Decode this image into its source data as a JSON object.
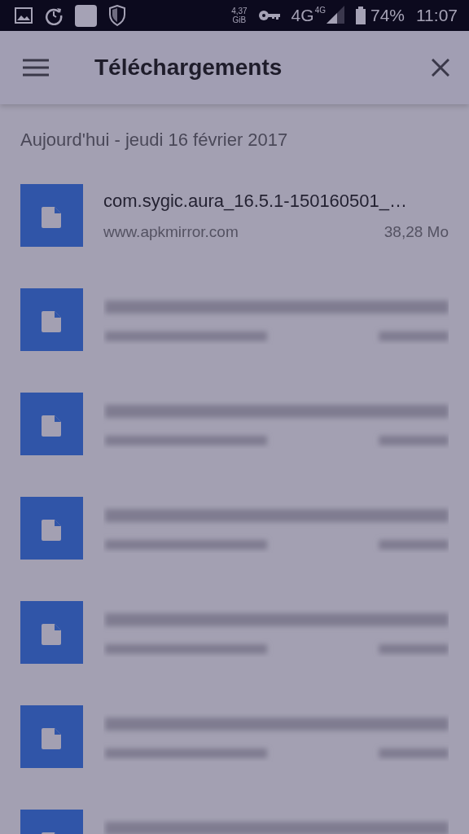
{
  "status_bar": {
    "storage": "4,37",
    "storage_unit": "GiB",
    "network": "4G",
    "network_small": "4G",
    "battery": "74%",
    "time": "11:07"
  },
  "toolbar": {
    "title": "Téléchargements"
  },
  "section": {
    "heading": "Aujourd'hui - jeudi 16 février 2017"
  },
  "downloads": [
    {
      "kind": "file",
      "name": "com.sygic.aura_16.5.1-150160501_…",
      "source": "www.apkmirror.com",
      "size": "38,28 Mo"
    },
    {
      "kind": "blurred"
    },
    {
      "kind": "blurred"
    },
    {
      "kind": "blurred"
    },
    {
      "kind": "blurred"
    },
    {
      "kind": "blurred"
    },
    {
      "kind": "blurred"
    }
  ]
}
